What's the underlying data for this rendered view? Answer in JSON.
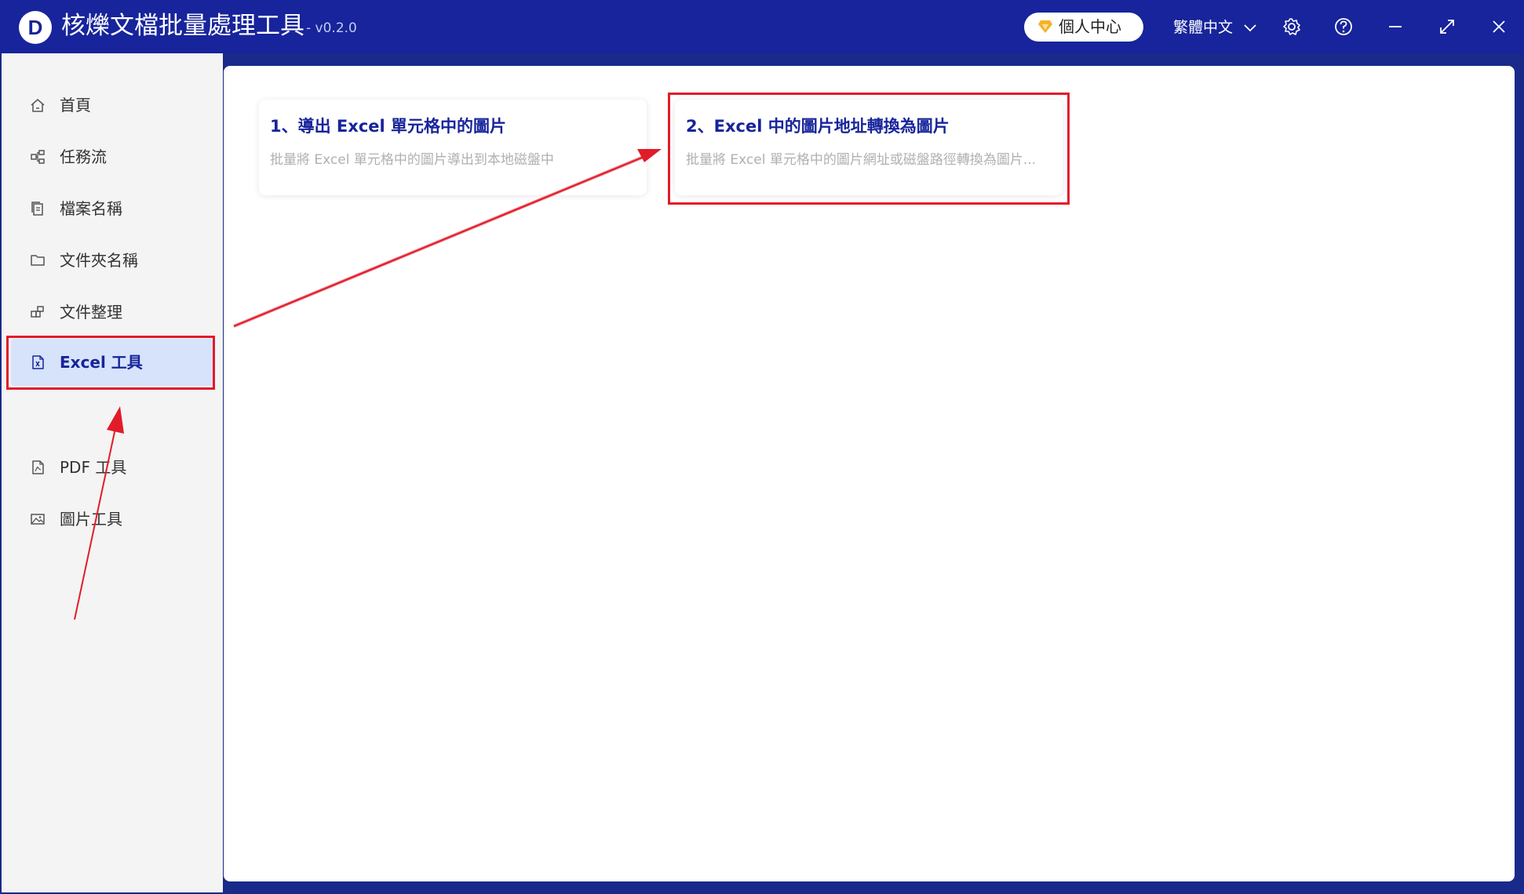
{
  "app": {
    "title": "核爍文檔批量處理工具",
    "version": "- v0.2.0",
    "logo_letter": "D"
  },
  "header": {
    "vip_label": "個人中心",
    "language": "繁體中文"
  },
  "sidebar": {
    "items": [
      {
        "label": "首頁",
        "icon": "home-icon"
      },
      {
        "label": "任務流",
        "icon": "workflow-icon"
      },
      {
        "label": "檔案名稱",
        "icon": "file-copy-icon"
      },
      {
        "label": "文件夾名稱",
        "icon": "folder-icon"
      },
      {
        "label": "文件整理",
        "icon": "organize-icon"
      },
      {
        "label": "Excel 工具",
        "icon": "excel-file-icon",
        "active": true
      },
      {
        "label": "PDF 工具",
        "icon": "pdf-file-icon"
      },
      {
        "label": "圖片工具",
        "icon": "image-icon"
      }
    ]
  },
  "cards": [
    {
      "title": "1、導出 Excel 單元格中的圖片",
      "desc": "批量將 Excel 單元格中的圖片導出到本地磁盤中"
    },
    {
      "title": "2、Excel 中的圖片地址轉換為圖片",
      "desc": "批量將 Excel 單元格中的圖片網址或磁盤路徑轉換為圖片..."
    }
  ],
  "colors": {
    "titlebar": "#17249b",
    "accent": "#17249b",
    "highlight": "#e21b2a",
    "active_bg": "#d6e3fb"
  }
}
